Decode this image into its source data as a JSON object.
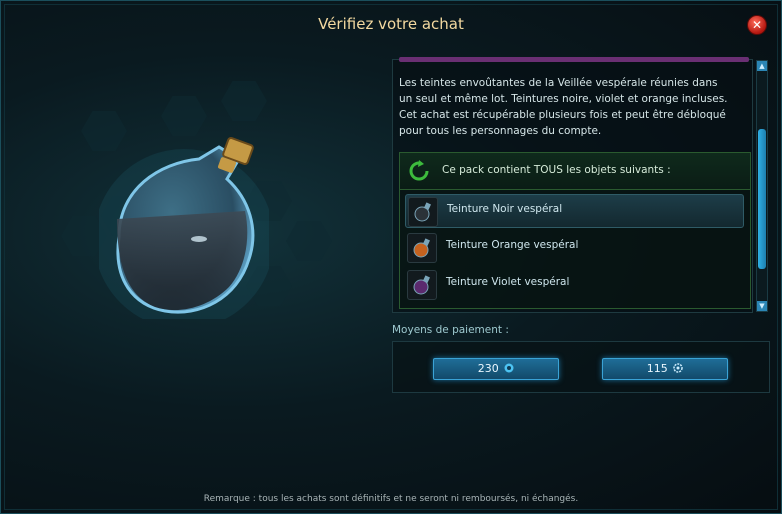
{
  "dialog": {
    "title": "Vérifiez votre achat",
    "close_icon": "close-icon"
  },
  "description": "Les teintes envoûtantes de la Veillée vespérale réunies dans un seul et même lot. Teintures noire, violet et orange incluses. Cet achat est récupérable plusieurs fois et peut être débloqué pour tous les personnages du compte.",
  "pack": {
    "title": "Ce pack contient TOUS les objets suivants :",
    "icon": "refresh-arrow-icon",
    "items": [
      {
        "label": "Teinture Noir vespéral",
        "icon": "black-dye-potion-icon",
        "selected": true
      },
      {
        "label": "Teinture Orange vespéral",
        "icon": "orange-dye-potion-icon",
        "selected": false
      },
      {
        "label": "Teinture Violet vespéral",
        "icon": "violet-dye-potion-icon",
        "selected": false
      }
    ]
  },
  "payment": {
    "label": "Moyens de paiement :",
    "options": [
      {
        "amount": "230",
        "currency_icon": "ogrines-icon"
      },
      {
        "amount": "115",
        "currency_icon": "kamas-icon"
      }
    ]
  },
  "remark": "Remarque : tous les achats sont définitifs et ne seront ni remboursés, ni échangés.",
  "colors": {
    "title": "#f3d9a0",
    "accent": "#2fb0e6",
    "close": "#d3241a",
    "pack_border": "#2a5a2f"
  }
}
